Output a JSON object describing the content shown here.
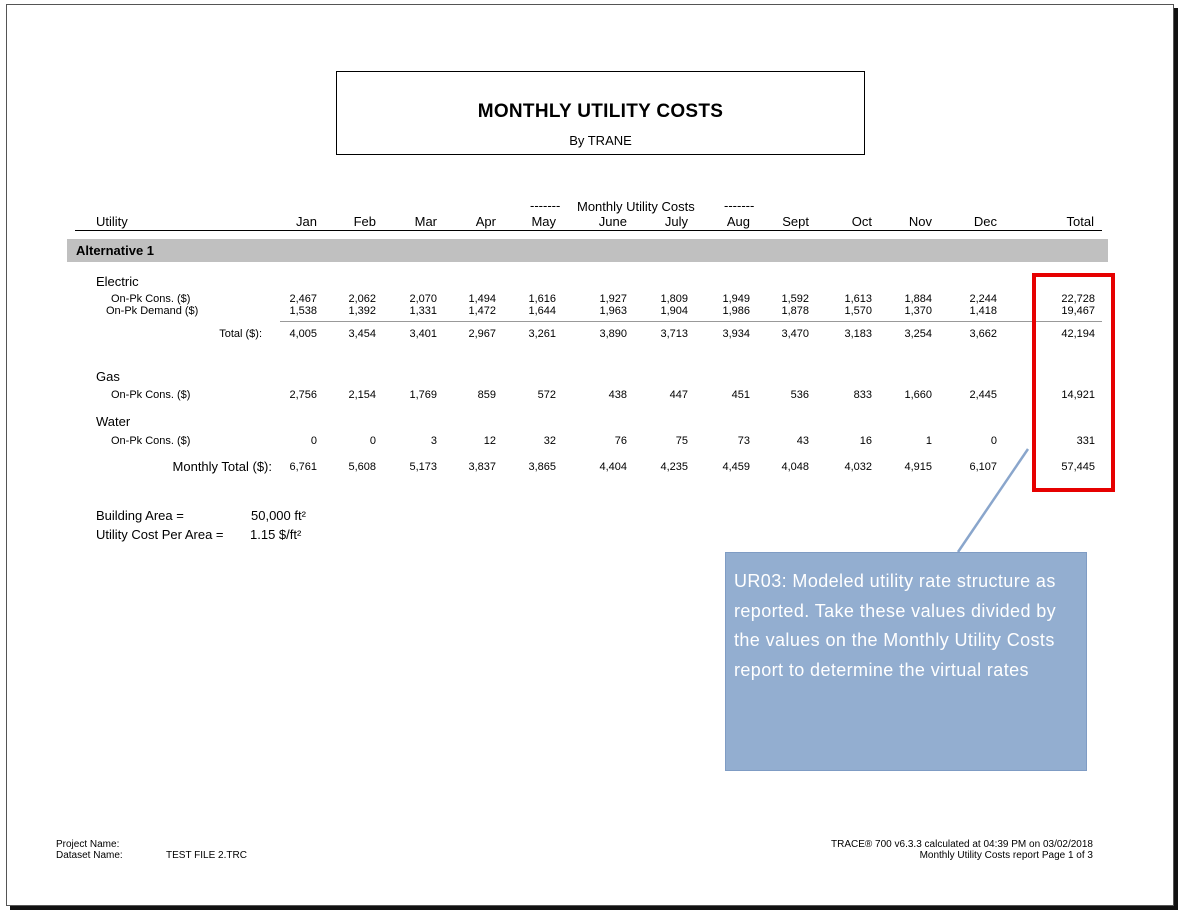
{
  "report": {
    "title": "MONTHLY UTILITY COSTS",
    "subtitle": "By TRANE",
    "group_header": {
      "left_dashes": "-------",
      "label": "Monthly Utility Costs",
      "right_dashes": "-------"
    },
    "col_utility": "Utility",
    "months": [
      "Jan",
      "Feb",
      "Mar",
      "Apr",
      "May",
      "June",
      "July",
      "Aug",
      "Sept",
      "Oct",
      "Nov",
      "Dec"
    ],
    "col_total": "Total",
    "alternative": "Alternative 1",
    "electric": {
      "label": "Electric",
      "rows": [
        {
          "label": "On-Pk Cons. ($)",
          "values": [
            "2,467",
            "2,062",
            "2,070",
            "1,494",
            "1,616",
            "1,927",
            "1,809",
            "1,949",
            "1,592",
            "1,613",
            "1,884",
            "2,244"
          ],
          "total": "22,728"
        },
        {
          "label": "On-Pk Demand ($)",
          "values": [
            "1,538",
            "1,392",
            "1,331",
            "1,472",
            "1,644",
            "1,963",
            "1,904",
            "1,986",
            "1,878",
            "1,570",
            "1,370",
            "1,418"
          ],
          "total": "19,467"
        }
      ],
      "subtotal": {
        "label": "Total ($):",
        "values": [
          "4,005",
          "3,454",
          "3,401",
          "2,967",
          "3,261",
          "3,890",
          "3,713",
          "3,934",
          "3,470",
          "3,183",
          "3,254",
          "3,662"
        ],
        "total": "42,194"
      }
    },
    "gas": {
      "label": "Gas",
      "row": {
        "label": "On-Pk Cons. ($)",
        "values": [
          "2,756",
          "2,154",
          "1,769",
          "859",
          "572",
          "438",
          "447",
          "451",
          "536",
          "833",
          "1,660",
          "2,445"
        ],
        "total": "14,921"
      }
    },
    "water": {
      "label": "Water",
      "row": {
        "label": "On-Pk Cons. ($)",
        "values": [
          "0",
          "0",
          "3",
          "12",
          "32",
          "76",
          "75",
          "73",
          "43",
          "16",
          "1",
          "0"
        ],
        "total": "331"
      }
    },
    "monthly_total": {
      "label": "Monthly Total ($):",
      "values": [
        "6,761",
        "5,608",
        "5,173",
        "3,837",
        "3,865",
        "4,404",
        "4,235",
        "4,459",
        "4,048",
        "4,032",
        "4,915",
        "6,107"
      ],
      "total": "57,445"
    },
    "building_area": {
      "label": "Building Area =",
      "value": "50,000 ft²"
    },
    "cost_per_area": {
      "label": "Utility Cost Per Area =",
      "value": "1.15 $/ft²"
    },
    "footer": {
      "project_label": "Project Name:",
      "dataset_label": "Dataset Name:",
      "dataset_value": "TEST FILE 2.TRC",
      "right_line1": "TRACE® 700 v6.3.3 calculated at 04:39 PM on 03/02/2018",
      "right_line2": "Monthly Utility Costs report  Page 1 of 3"
    }
  },
  "callout": {
    "text": "UR03: Modeled utility rate structure as reported.  Take these values divided by the values on the Monthly Utility Costs report to determine the virtual rates",
    "box_color": "#93aed0",
    "highlight_color": "#e60000"
  }
}
